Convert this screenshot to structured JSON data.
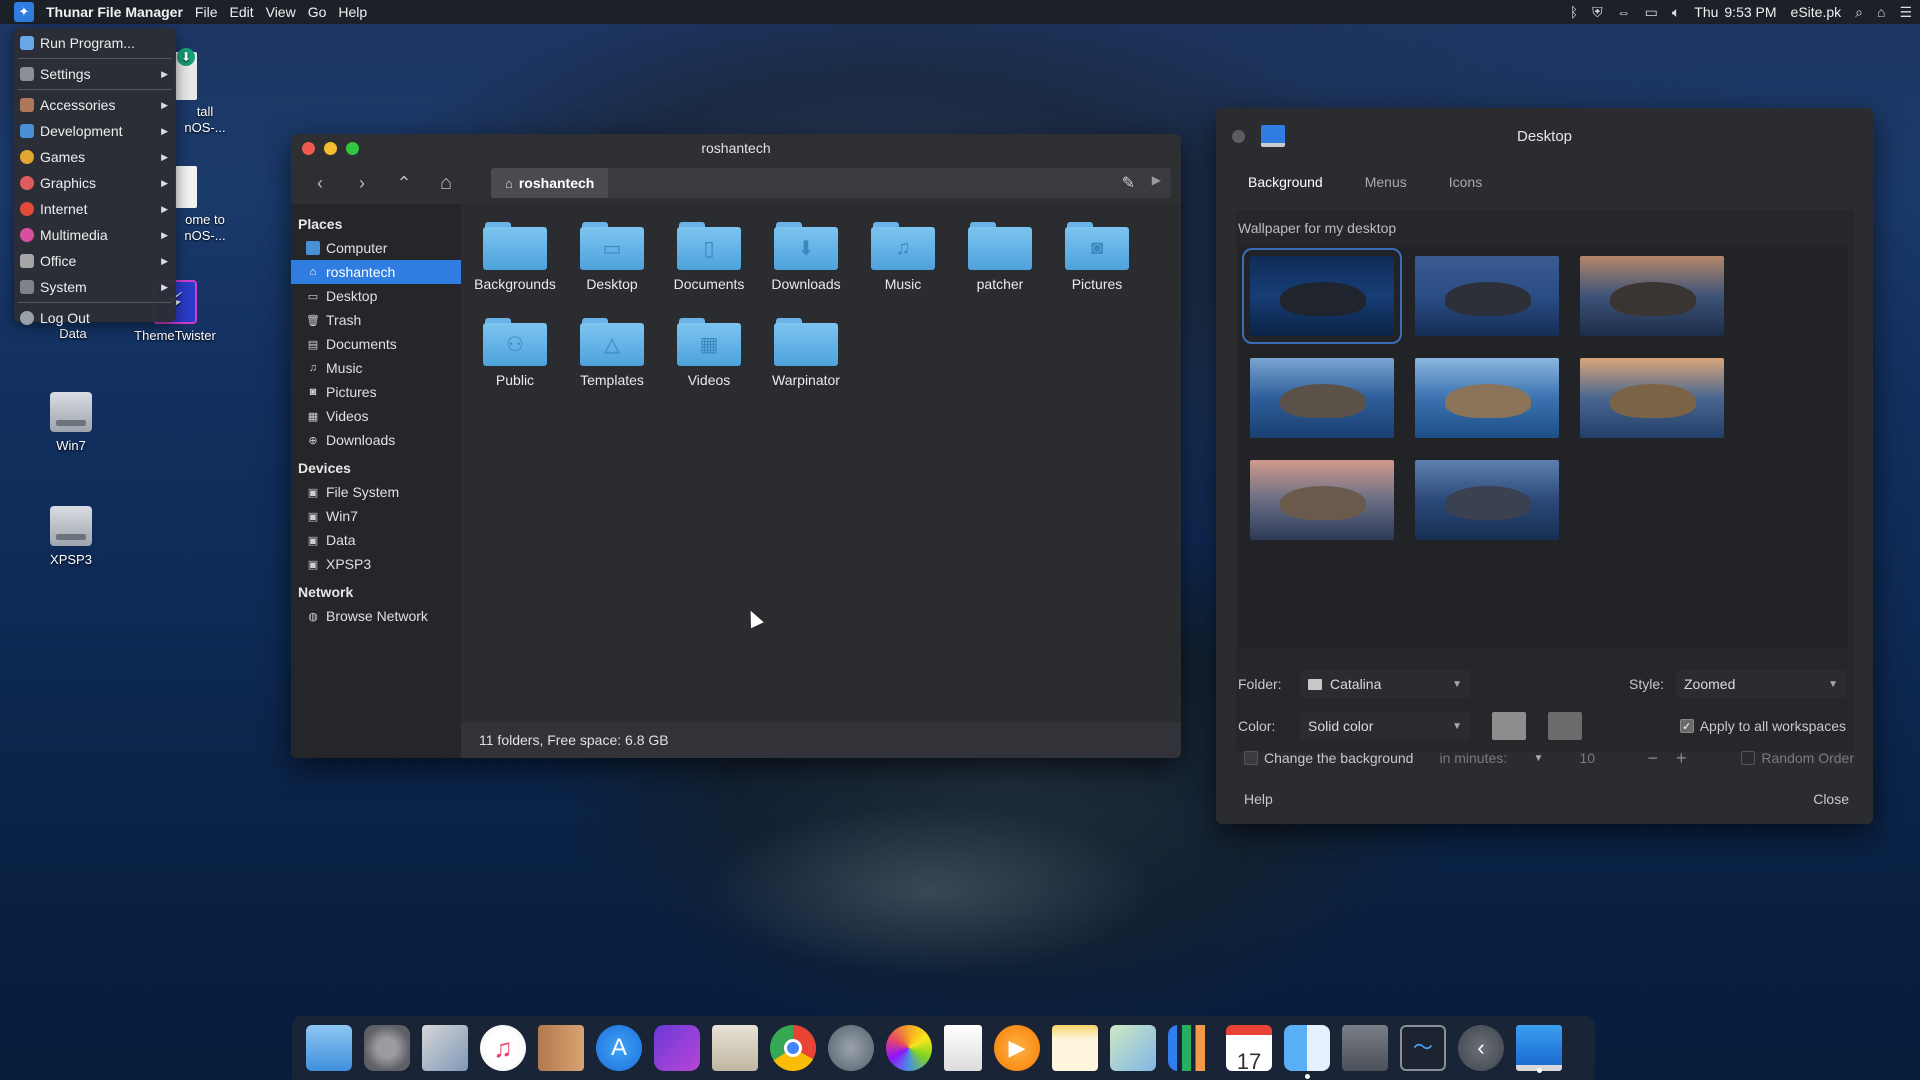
{
  "menubar": {
    "app_name": "Thunar File Manager",
    "menus": [
      "File",
      "Edit",
      "View",
      "Go",
      "Help"
    ],
    "clock_day": "Thu",
    "clock_time": "9:53 PM",
    "brand": "eSite.pk"
  },
  "app_menu": {
    "items": [
      {
        "label": "Run Program...",
        "icon": "run-icon",
        "submenu": false
      },
      {
        "label": "Settings",
        "icon": "settings-icon",
        "submenu": true
      },
      {
        "label": "Accessories",
        "icon": "accessories-icon",
        "submenu": true
      },
      {
        "label": "Development",
        "icon": "development-icon",
        "submenu": true
      },
      {
        "label": "Games",
        "icon": "games-icon",
        "submenu": true
      },
      {
        "label": "Graphics",
        "icon": "graphics-icon",
        "submenu": true
      },
      {
        "label": "Internet",
        "icon": "internet-icon",
        "submenu": true
      },
      {
        "label": "Multimedia",
        "icon": "multimedia-icon",
        "submenu": true
      },
      {
        "label": "Office",
        "icon": "office-icon",
        "submenu": true
      },
      {
        "label": "System",
        "icon": "system-icon",
        "submenu": true
      },
      {
        "label": "Log Out",
        "icon": "logout-icon",
        "submenu": false
      }
    ]
  },
  "desktop_icons": [
    {
      "label": "Install RoshanOS-...",
      "visible_label": "tall\nnOS-..."
    },
    {
      "label": "Welcome to RoshanOS-...",
      "visible_label": "ome to\nnOS-..."
    },
    {
      "label": "Data"
    },
    {
      "label": "ThemeTwister"
    },
    {
      "label": "Win7"
    },
    {
      "label": "XPSP3"
    }
  ],
  "thunar": {
    "title": "roshantech",
    "path_crumb": "roshantech",
    "sidebar": {
      "places_header": "Places",
      "places": [
        "Computer",
        "roshantech",
        "Desktop",
        "Trash",
        "Documents",
        "Music",
        "Pictures",
        "Videos",
        "Downloads"
      ],
      "devices_header": "Devices",
      "devices": [
        "File System",
        "Win7",
        "Data",
        "XPSP3"
      ],
      "network_header": "Network",
      "network": [
        "Browse Network"
      ]
    },
    "folders": [
      "Backgrounds",
      "Desktop",
      "Documents",
      "Downloads",
      "Music",
      "patcher",
      "Pictures",
      "Public",
      "Templates",
      "Videos",
      "Warpinator"
    ],
    "status": "11 folders, Free space: 6.8 GB"
  },
  "desktop_settings": {
    "title": "Desktop",
    "tabs": [
      "Background",
      "Menus",
      "Icons"
    ],
    "subtitle": "Wallpaper for my desktop",
    "folder_label": "Folder:",
    "folder_value": "Catalina",
    "style_label": "Style:",
    "style_value": "Zoomed",
    "color_label": "Color:",
    "color_value": "Solid color",
    "apply_all": "Apply to all workspaces",
    "change_bg": "Change the background",
    "interval_unit": "in minutes:",
    "interval_value": "10",
    "random_order": "Random Order",
    "help": "Help",
    "close": "Close"
  },
  "dock": {
    "apps": [
      "Files",
      "System Preferences",
      "Mail",
      "iTunes",
      "Contacts",
      "App Store",
      "Video Editor",
      "Calculator",
      "Chrome",
      "Launchpad",
      "Photos",
      "TextEdit",
      "Media Player",
      "Notes",
      "Maps",
      "Charts",
      "Calendar",
      "Finder",
      "Screenshot",
      "Activity Monitor",
      "Back",
      "Desktop Settings"
    ],
    "calendar_day": "17"
  }
}
